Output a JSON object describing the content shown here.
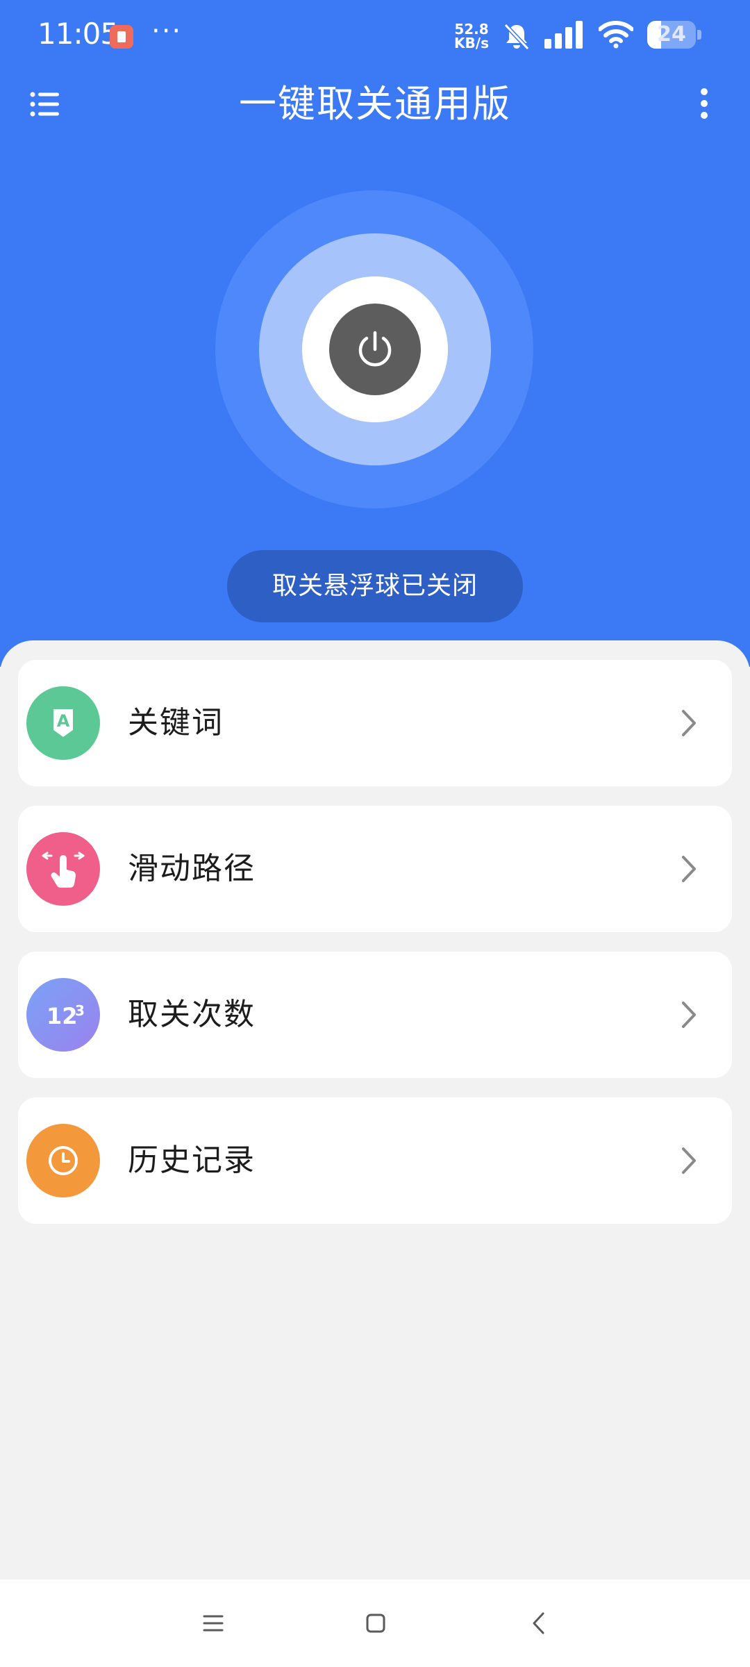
{
  "status_bar": {
    "time": "11:05",
    "more_dots": "···",
    "speed_value": "52.8",
    "speed_unit": "KB/s",
    "battery": "24"
  },
  "header": {
    "title": "一键取关通用版",
    "menu_icon": "menu-icon",
    "more_icon": "more-vertical-icon"
  },
  "power": {
    "icon": "power-icon",
    "status_text": "取关悬浮球已关闭"
  },
  "menu": {
    "items": [
      {
        "label": "关键词",
        "icon": "keyword-icon",
        "color": "#5cc896"
      },
      {
        "label": "滑动路径",
        "icon": "swipe-hand-icon",
        "color": "#ef5f8a"
      },
      {
        "label": "取关次数",
        "icon": "numbers-icon",
        "color": "#8b90f0"
      },
      {
        "label": "历史记录",
        "icon": "clock-icon",
        "color": "#f3993c"
      }
    ]
  },
  "colors": {
    "primary": "#3b79f5",
    "pill": "#2d5fc4",
    "power_button": "#5d5d5d",
    "background": "#f2f2f3"
  },
  "nav": {
    "recent_icon": "recent-apps-icon",
    "home_icon": "home-icon",
    "back_icon": "back-icon"
  }
}
